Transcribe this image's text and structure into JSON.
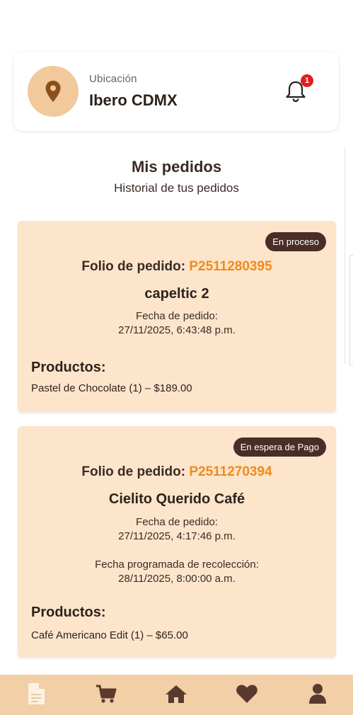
{
  "header": {
    "location_label": "Ubicación",
    "location_value": "Ibero CDMX",
    "notification_count": "1"
  },
  "main": {
    "title": "Mis pedidos",
    "subtitle": "Historial de tus pedidos"
  },
  "orders": [
    {
      "status": "En proceso",
      "folio_label": "Folio de pedido:",
      "folio": "P2511280395",
      "store": "capeltic 2",
      "date_label": "Fecha de pedido:",
      "date": "27/11/2025, 6:43:48 p.m.",
      "products_label": "Productos:",
      "products": [
        "Pastel de Chocolate (1) – $189.00"
      ]
    },
    {
      "status": "En espera de Pago",
      "folio_label": "Folio de pedido:",
      "folio": "P2511270394",
      "store": "Cielito Querido Café",
      "date_label": "Fecha de pedido:",
      "date": "27/11/2025, 4:17:46 p.m.",
      "pickup_label": "Fecha programada de recolección:",
      "pickup": "28/11/2025, 8:00:00 a.m.",
      "products_label": "Productos:",
      "products": [
        "Café Americano  Edit (1) – $65.00"
      ]
    }
  ],
  "nav": {
    "items": [
      "orders-icon",
      "cart-icon",
      "home-icon",
      "heart-icon",
      "user-icon"
    ]
  },
  "colors": {
    "accent": "#f08a1c",
    "card_bg": "#fce5cb",
    "badge_bg": "#4a2e26",
    "nav_bg": "#f2cfa6",
    "brown": "#8a4f1a"
  }
}
